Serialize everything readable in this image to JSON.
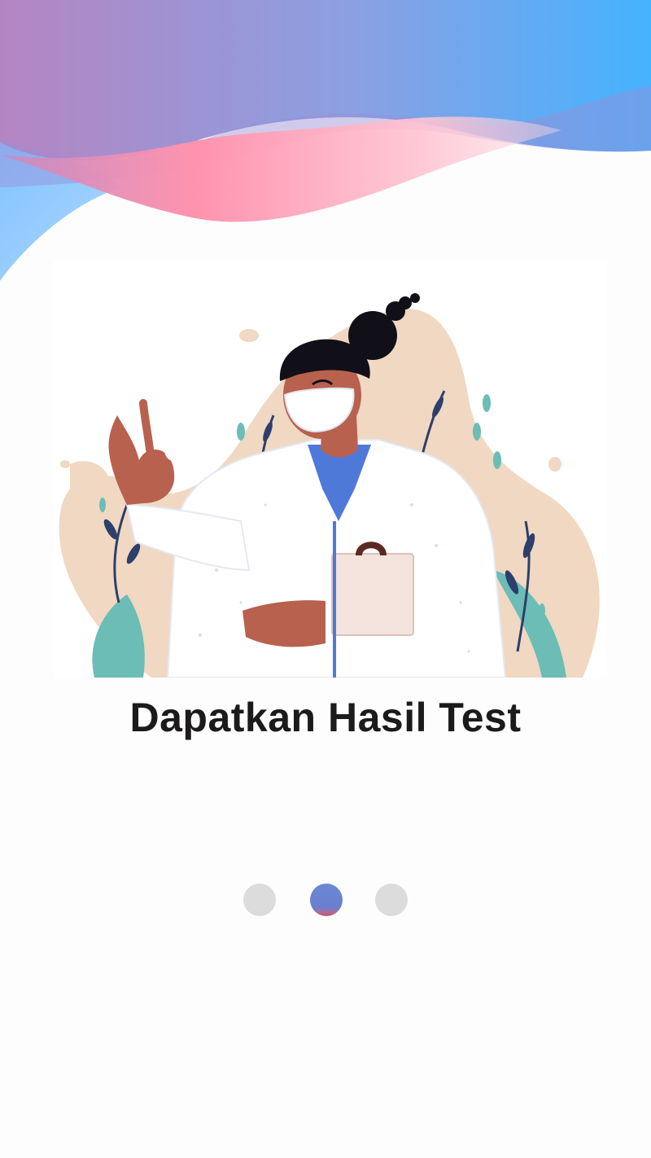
{
  "onboarding": {
    "title": "Dapatkan Hasil Test",
    "page_indicator": {
      "total": 3,
      "active_index": 1
    }
  },
  "colors": {
    "background": "#fdfdfd",
    "wave_blue": "#4fb1fc",
    "wave_purple": "#b07fc0",
    "wave_pink": "#ff97b1",
    "dot_inactive": "#dcdcdc",
    "dot_active": "#6b86d2",
    "title_text": "#1c1a1a"
  },
  "illustration": {
    "subject": "doctor-with-mask-ok-hand-icon"
  }
}
